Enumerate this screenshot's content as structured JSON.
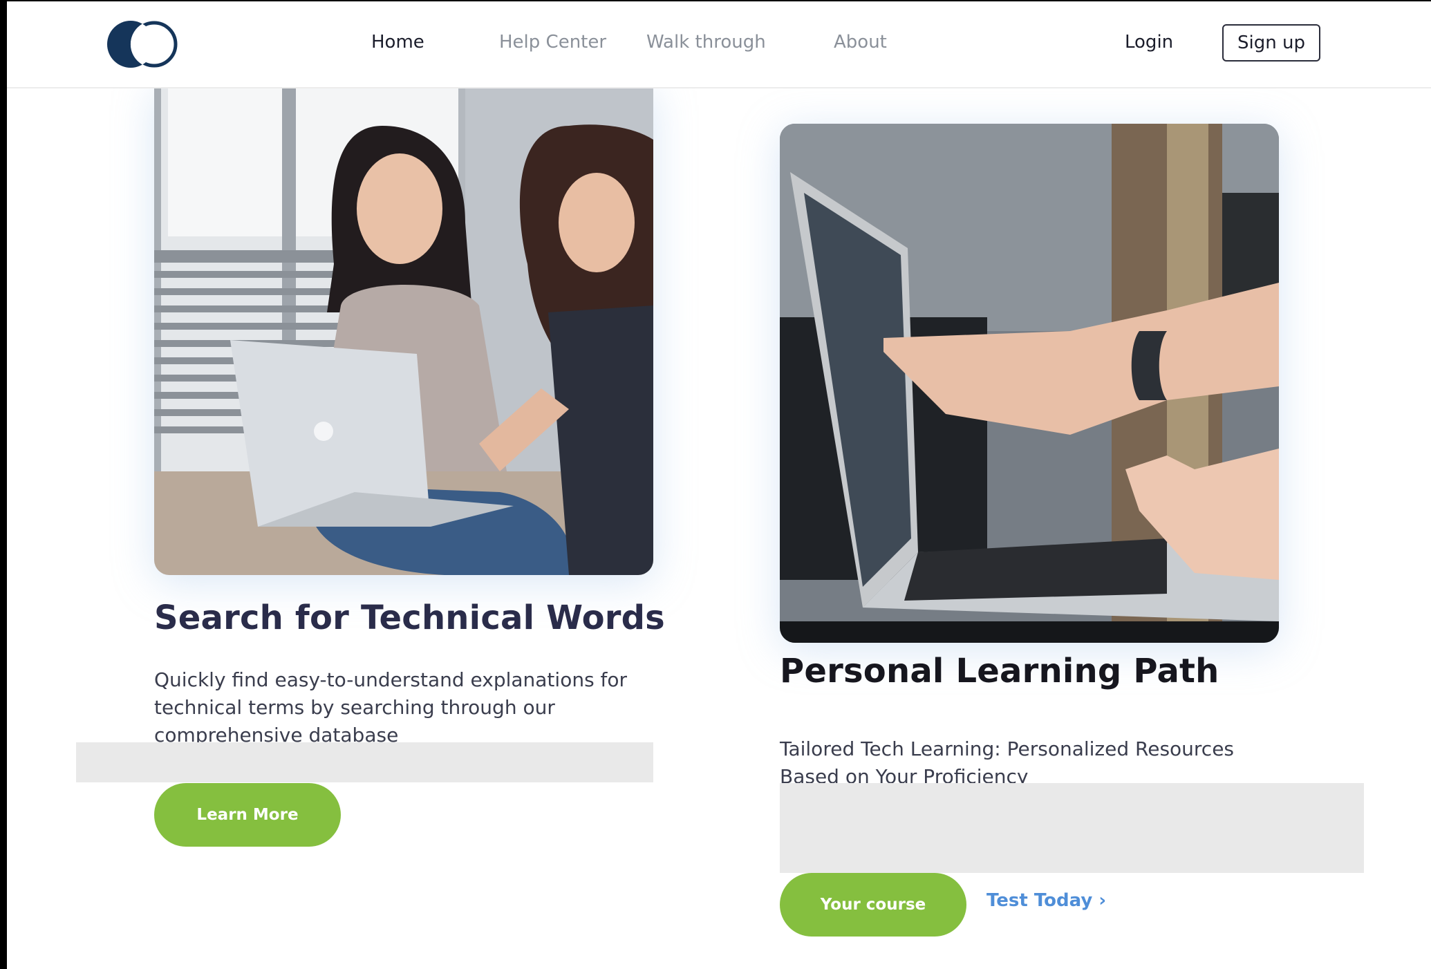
{
  "nav": {
    "logo": "site-logo",
    "links": [
      "Home",
      "Help Center",
      "Walk through",
      "About"
    ],
    "active": "Home",
    "login": "Login",
    "signup": "Sign up"
  },
  "cards": [
    {
      "image": "students-with-laptop-photo",
      "title": "Search for Technical Words",
      "description": "Quickly find easy-to-understand explanations for technical terms by searching through our comprehensive database",
      "button": "Learn More"
    },
    {
      "image": "hands-pointing-at-laptop-photo",
      "title": "Personal Learning Path",
      "description": "Tailored Tech Learning: Personalized Resources Based on Your Proficiency",
      "button": "Your course",
      "link": "Test Today ›"
    }
  ],
  "colors": {
    "accent_green": "#85bf3f",
    "link_blue": "#4f8ed8",
    "logo_navy": "#15355a",
    "heading": "#2a2c4a"
  }
}
